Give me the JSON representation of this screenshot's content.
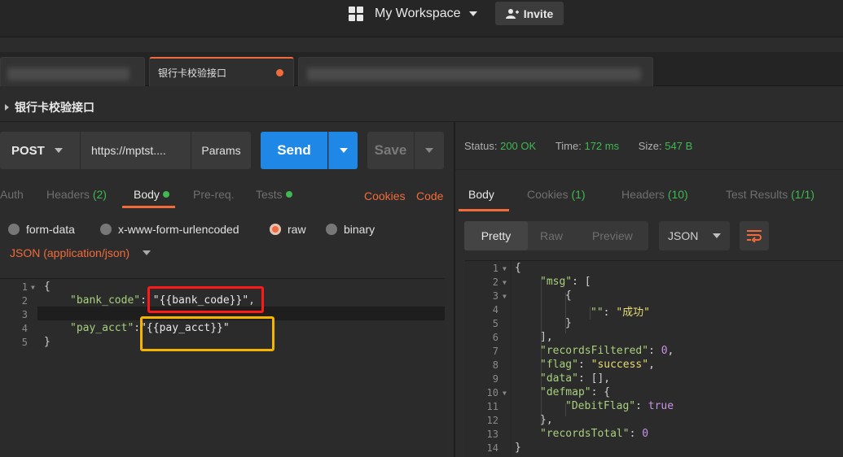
{
  "workspace": {
    "name": "My Workspace",
    "invite_label": "Invite"
  },
  "tabs": {
    "active_label": "银行卡校验接口"
  },
  "request": {
    "title": "银行卡校验接口",
    "method": "POST",
    "url": "https://mptst....",
    "params_label": "Params",
    "send_label": "Send",
    "save_label": "Save",
    "subtabs": {
      "auth": "Auth",
      "headers": "Headers",
      "headers_count": "(2)",
      "body": "Body",
      "prereq": "Pre-req.",
      "tests": "Tests",
      "cookies": "Cookies",
      "code": "Code"
    },
    "body_types": [
      "form-data",
      "x-www-form-urlencoded",
      "raw",
      "binary"
    ],
    "content_type": "JSON (application/json)",
    "editor": {
      "line_numbers": [
        "1",
        "2",
        "3",
        "4",
        "5"
      ],
      "l1": "{",
      "l2_key": "\"bank_code\"",
      "l2_colon": ":",
      "l2_val": "\"{{bank_code}}\"",
      "l2_comma": ",",
      "l4_key": "\"pay_acct\"",
      "l4_colon": ":",
      "l4_val": "\"{{pay_acct}}\"",
      "l5": "}"
    }
  },
  "response": {
    "status_label": "Status:",
    "status_value": "200 OK",
    "time_label": "Time:",
    "time_value": "172 ms",
    "size_label": "Size:",
    "size_value": "547 B",
    "tabs": {
      "body": "Body",
      "cookies": "Cookies",
      "cookies_count": "(1)",
      "headers": "Headers",
      "headers_count": "(10)",
      "tests": "Test Results",
      "tests_count": "(1/1)"
    },
    "view_modes": {
      "pretty": "Pretty",
      "raw": "Raw",
      "preview": "Preview"
    },
    "format": "JSON",
    "editor": {
      "line_numbers": [
        "1",
        "2",
        "3",
        "4",
        "5",
        "6",
        "7",
        "8",
        "9",
        "10",
        "11",
        "12",
        "13",
        "14"
      ],
      "l1": "{",
      "l2_key": "\"msg\"",
      "l2_rest": ": [",
      "l3": "{",
      "l4_key": "\"\"",
      "l4_colon": ": ",
      "l4_val": "\"成功\"",
      "l5": "}",
      "l6": "],",
      "l7_key": "\"recordsFiltered\"",
      "l7_colon": ": ",
      "l7_val": "0",
      "l7_comma": ",",
      "l8_key": "\"flag\"",
      "l8_colon": ": ",
      "l8_val": "\"success\"",
      "l8_comma": ",",
      "l9_key": "\"data\"",
      "l9_rest": ": [],",
      "l10_key": "\"defmap\"",
      "l10_rest": ": {",
      "l11_key": "\"DebitFlag\"",
      "l11_colon": ": ",
      "l11_val": "true",
      "l12": "},",
      "l13_key": "\"recordsTotal\"",
      "l13_colon": ": ",
      "l13_val": "0",
      "l14": "}"
    }
  },
  "colors": {
    "accent": "#f26b3a",
    "send": "#1f87e5",
    "success": "#3fb950",
    "highlight_red": "#ff1a1a",
    "highlight_yellow": "#f5b400"
  },
  "icons": {
    "workspace": "grid-icon",
    "invite": "add-user-icon",
    "wrap": "wrap-lines-icon"
  }
}
